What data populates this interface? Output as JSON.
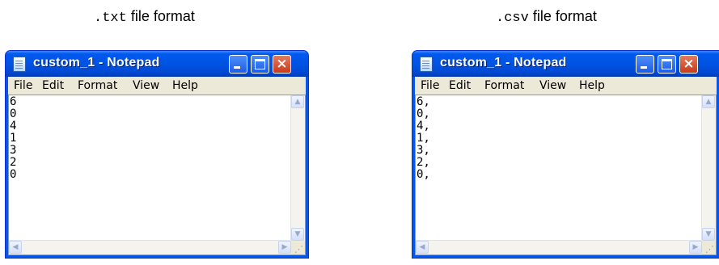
{
  "captions": [
    {
      "ext": ".txt",
      "label": "file format"
    },
    {
      "ext": ".csv",
      "label": "file format"
    }
  ],
  "windows": [
    {
      "title": "custom_1 - Notepad",
      "menu": [
        "File",
        "Edit",
        "Format",
        "View",
        "Help"
      ],
      "content": "6\n0\n4\n1\n3\n2\n0"
    },
    {
      "title": "custom_1 - Notepad",
      "menu": [
        "File",
        "Edit",
        "Format",
        "View",
        "Help"
      ],
      "content": "6,\n0,\n4,\n1,\n3,\n2,\n0,"
    }
  ],
  "icons": {
    "minimize": "minimize-icon",
    "maximize": "maximize-icon",
    "close": "×",
    "scroll_up": "▲",
    "scroll_down": "▼",
    "scroll_left": "◀",
    "scroll_right": "▶"
  },
  "colors": {
    "titlebar": "#0054e3",
    "close_button": "#c73a1a",
    "menubar": "#ece9d8"
  }
}
